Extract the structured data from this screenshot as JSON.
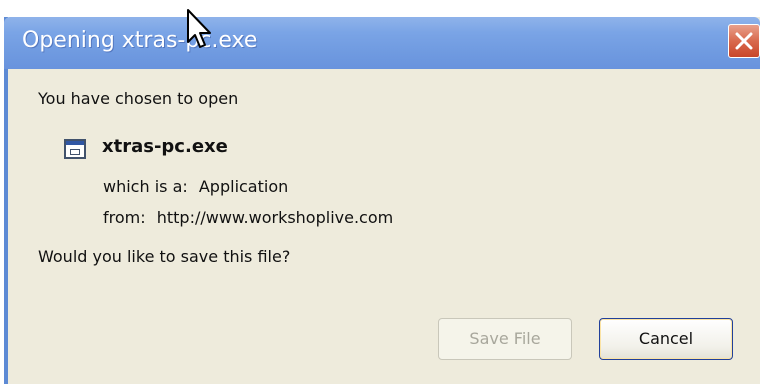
{
  "window": {
    "title": "Opening xtras-pc.exe"
  },
  "dialog": {
    "intro": "You have chosen to open",
    "file_name": "xtras-pc.exe",
    "type_label": "which is a:",
    "type_value": "Application",
    "from_label": "from:",
    "from_value": "http://www.workshoplive.com",
    "question": "Would you like to save this file?"
  },
  "buttons": {
    "save_label": "Save File",
    "save_enabled": false,
    "cancel_label": "Cancel"
  },
  "icons": {
    "file": "application-file-icon",
    "close": "close-icon",
    "cursor": "mouse-cursor-icon"
  },
  "colors": {
    "titlebar": "#7aa4e6",
    "dialog_bg": "#eeebdc",
    "close_button": "#d9694d"
  }
}
